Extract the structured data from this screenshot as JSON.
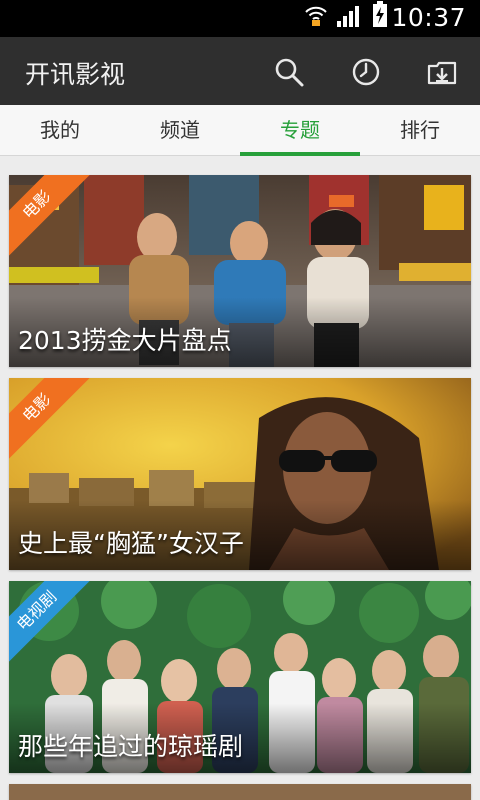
{
  "status": {
    "time": "10:37"
  },
  "app": {
    "title": "开讯影视"
  },
  "tabs": [
    {
      "label": "我的"
    },
    {
      "label": "频道"
    },
    {
      "label": "专题",
      "active": true
    },
    {
      "label": "排行"
    }
  ],
  "cards": [
    {
      "tag": "电影",
      "tag_color": "#f07020",
      "title": "2013捞金大片盘点"
    },
    {
      "tag": "电影",
      "tag_color": "#f07020",
      "title": "史上最“胸猛”女汉子"
    },
    {
      "tag": "电视剧",
      "tag_color": "#2a96d8",
      "title": "那些年追过的琼瑶剧"
    }
  ],
  "colors": {
    "accent": "#27a03a",
    "appbar": "#2f2f2f",
    "statusbar": "#000000"
  },
  "icons": [
    "wifi-icon",
    "signal-icon",
    "battery-charging-icon",
    "search-icon",
    "history-clock-icon",
    "download-icon"
  ]
}
